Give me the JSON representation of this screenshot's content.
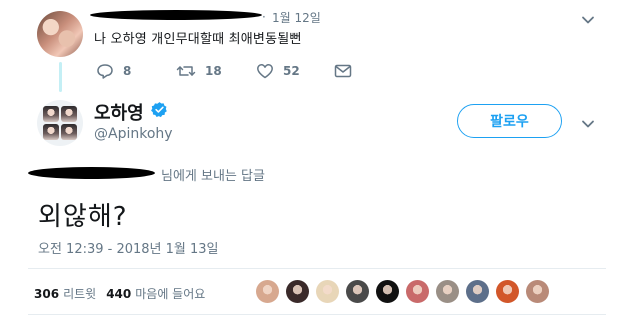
{
  "parent_tweet": {
    "dot": "·",
    "date": "1월 12일",
    "text": "나 오하영 개인무대할때 최애변동될뻔",
    "actions": {
      "reply_count": "8",
      "retweet_count": "18",
      "like_count": "52"
    },
    "icons": [
      "reply-icon",
      "retweet-icon",
      "heart-icon",
      "envelope-icon",
      "chevron-down-icon"
    ]
  },
  "main_tweet": {
    "display_name": "오하영",
    "handle": "@Apinkohy",
    "follow_label": "팔로우",
    "reply_context_suffix": "님에게 보내는 답글",
    "text": "외않해?",
    "timestamp": "오전 12:39 - 2018년 1월 13일",
    "icons": [
      "verified-badge-icon",
      "chevron-down-icon"
    ]
  },
  "stats": {
    "retweets_count": "306",
    "retweets_label": "리트윗",
    "likes_count": "440",
    "likes_label": "마음에 들어요"
  },
  "likers": [
    {
      "name": "liker-avatar",
      "color": "#d7a88f"
    },
    {
      "name": "liker-avatar",
      "color": "#3a2a2a"
    },
    {
      "name": "liker-avatar",
      "color": "#e8d6b8"
    },
    {
      "name": "liker-avatar",
      "color": "#4a4a4a"
    },
    {
      "name": "liker-avatar",
      "color": "#111111"
    },
    {
      "name": "liker-avatar",
      "color": "#c96a6a"
    },
    {
      "name": "liker-avatar",
      "color": "#9a8f86"
    },
    {
      "name": "liker-avatar",
      "color": "#5d6f8a"
    },
    {
      "name": "liker-avatar",
      "color": "#d2572a"
    },
    {
      "name": "liker-avatar",
      "color": "#b98a78"
    }
  ],
  "colors": {
    "accent": "#1da1f2",
    "secondary_text": "#657786",
    "primary_text": "#14171a",
    "thread_line": "#c4eff5",
    "divider": "#e6ecf0"
  }
}
